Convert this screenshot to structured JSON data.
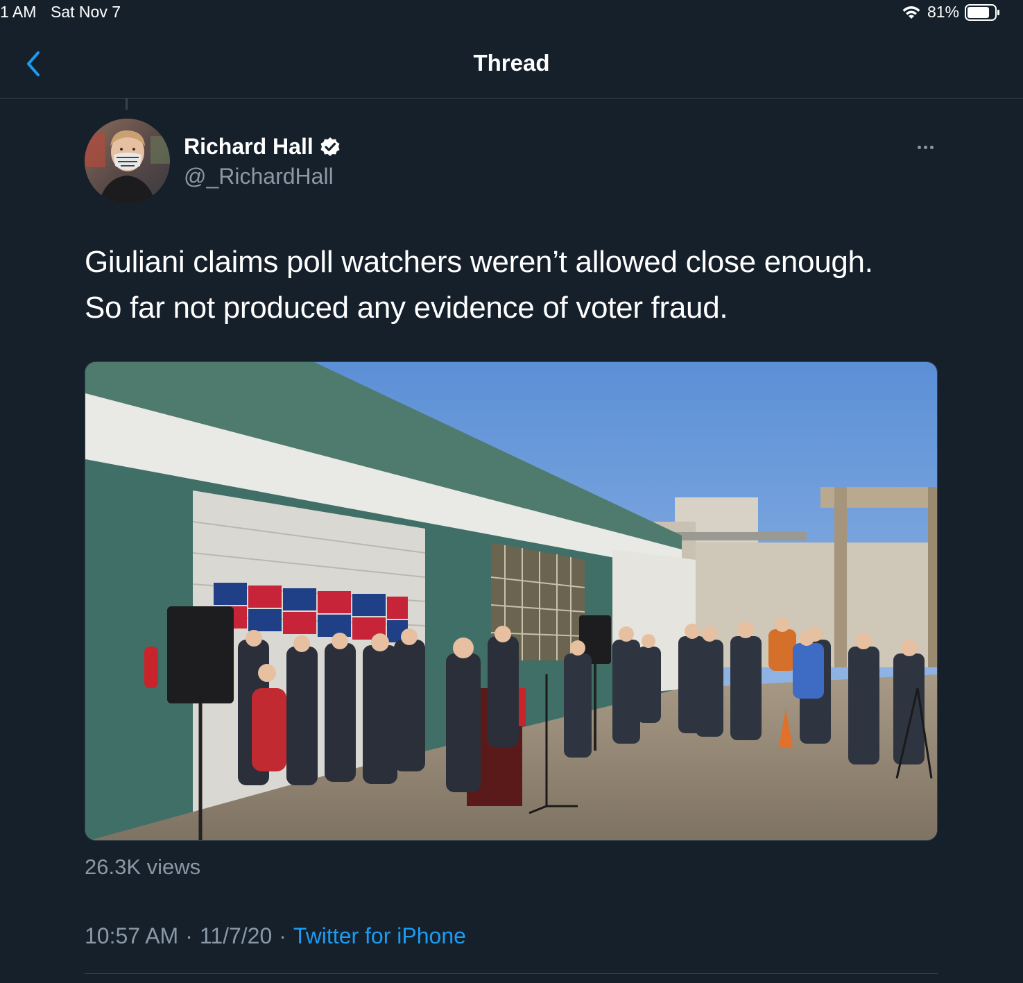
{
  "status_bar": {
    "time": "1 AM",
    "date": "Sat Nov 7",
    "battery": "81%",
    "battery_level": 0.81
  },
  "nav": {
    "title": "Thread",
    "back_icon": "chevron-left-icon"
  },
  "tweet": {
    "author_name": "Richard Hall",
    "handle": "@_RichardHall",
    "verified": true,
    "text_lines": [
      "Giuliani claims poll watchers weren’t allowed close enough.",
      "So far not produced any evidence of voter fraud."
    ],
    "views": "26.3K views",
    "time": "10:57 AM",
    "date": "11/7/20",
    "separator": "·",
    "source": "Twitter for iPhone"
  },
  "colors": {
    "background": "#15202b",
    "accent": "#1d9bf0",
    "secondary_text": "#8b98a5",
    "divider": "#38444d"
  }
}
